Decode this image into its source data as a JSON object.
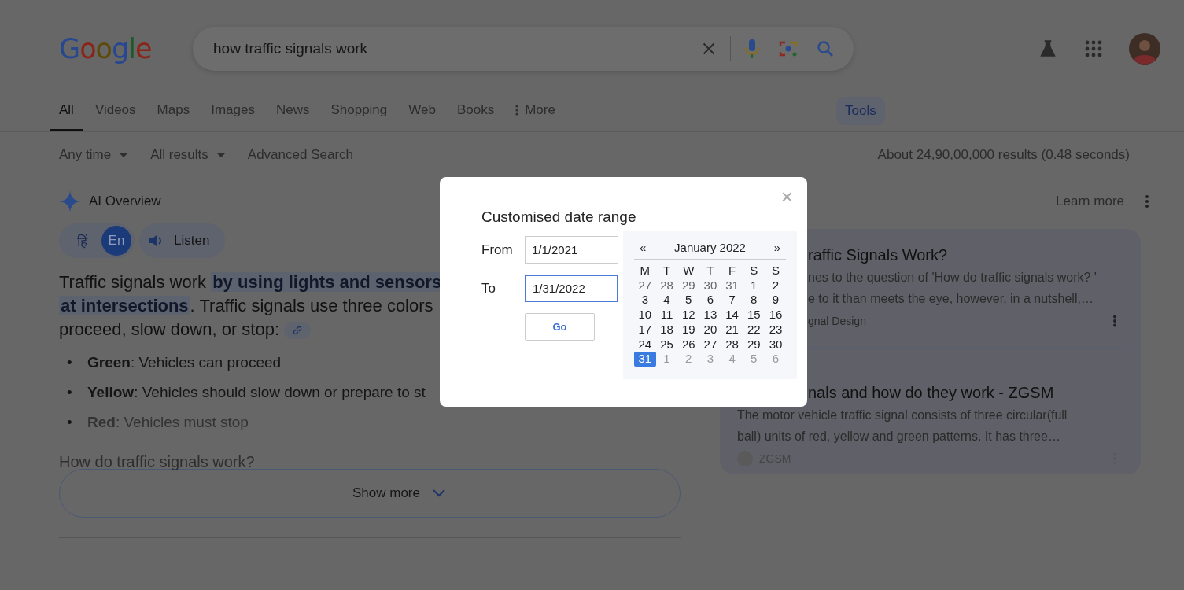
{
  "header": {
    "logo": "Google",
    "query": "how traffic signals work"
  },
  "tabs": [
    {
      "label": "All",
      "selected": true
    },
    {
      "label": "Videos",
      "selected": false
    },
    {
      "label": "Maps",
      "selected": false
    },
    {
      "label": "Images",
      "selected": false
    },
    {
      "label": "News",
      "selected": false
    },
    {
      "label": "Shopping",
      "selected": false
    },
    {
      "label": "Web",
      "selected": false
    },
    {
      "label": "Books",
      "selected": false
    },
    {
      "label": "More",
      "selected": false,
      "kind": "more"
    }
  ],
  "tools": "Tools",
  "filters": [
    {
      "label": "Any time",
      "kind": "dropdown"
    },
    {
      "label": "All results",
      "kind": "dropdown"
    },
    {
      "label": "Advanced Search",
      "kind": "link"
    }
  ],
  "result_stats": "About 24,90,00,000 results (0.48 seconds)",
  "ai_overview": {
    "title": "AI Overview",
    "learn_more": "Learn more",
    "languages": [
      {
        "label": "हिं",
        "selected": false
      },
      {
        "label": "En",
        "selected": true
      }
    ],
    "listen": "Listen",
    "paragraph": [
      "Traffic signals work ",
      "by using lights and sensors",
      "at intersections",
      ". Traffic signals use three colors",
      "proceed, slow down, or stop:"
    ],
    "bullets": [
      {
        "marker": "•",
        "term": "Green",
        "text": ": Vehicles can proceed",
        "faded": false
      },
      {
        "marker": "•",
        "term": "Yellow",
        "text": ": Vehicles should slow down or prepare to st",
        "faded": false
      },
      {
        "marker": "•",
        "term": "Red",
        "text": ": Vehicles must stop",
        "faded": true
      }
    ],
    "faded_heading": "How do traffic signals work?",
    "show_more": "Show more"
  },
  "sources": [
    {
      "title": "raffic Signals Work?",
      "snippet": [
        "nes to the question of 'How do traffic signals work? '",
        "e to it than meets the eye, however, in a nutshell,…"
      ],
      "site": "gnal Design",
      "covered": true
    },
    {
      "title": "nals and how do they work - ZGSM",
      "snippet": [
        "The motor vehicle traffic signal consists of three circular(full",
        "ball) units of red, yellow and green patterns. It has three…"
      ],
      "site": "ZGSM",
      "covered": false
    }
  ],
  "dialog": {
    "title": "Customised date range",
    "close": "×",
    "fields": [
      {
        "label": "From",
        "value": "1/1/2021",
        "focused": false
      },
      {
        "label": "To",
        "value": "1/31/2022",
        "focused": true
      }
    ],
    "go": "Go",
    "calendar": {
      "prev": "«",
      "month": "January 2022",
      "next": "»",
      "weekdays": [
        "M",
        "T",
        "W",
        "T",
        "F",
        "S",
        "S"
      ],
      "days": [
        {
          "d": "27",
          "muted": true,
          "selected": false
        },
        {
          "d": "28",
          "muted": true,
          "selected": false
        },
        {
          "d": "29",
          "muted": true,
          "selected": false
        },
        {
          "d": "30",
          "muted": true,
          "selected": false
        },
        {
          "d": "31",
          "muted": true,
          "selected": false
        },
        {
          "d": "1",
          "muted": false,
          "selected": false
        },
        {
          "d": "2",
          "muted": false,
          "selected": false
        },
        {
          "d": "3",
          "muted": false,
          "selected": false
        },
        {
          "d": "4",
          "muted": false,
          "selected": false
        },
        {
          "d": "5",
          "muted": false,
          "selected": false
        },
        {
          "d": "6",
          "muted": false,
          "selected": false
        },
        {
          "d": "7",
          "muted": false,
          "selected": false
        },
        {
          "d": "8",
          "muted": false,
          "selected": false
        },
        {
          "d": "9",
          "muted": false,
          "selected": false
        },
        {
          "d": "10",
          "muted": false,
          "selected": false
        },
        {
          "d": "11",
          "muted": false,
          "selected": false
        },
        {
          "d": "12",
          "muted": false,
          "selected": false
        },
        {
          "d": "13",
          "muted": false,
          "selected": false
        },
        {
          "d": "14",
          "muted": false,
          "selected": false
        },
        {
          "d": "15",
          "muted": false,
          "selected": false
        },
        {
          "d": "16",
          "muted": false,
          "selected": false
        },
        {
          "d": "17",
          "muted": false,
          "selected": false
        },
        {
          "d": "18",
          "muted": false,
          "selected": false
        },
        {
          "d": "19",
          "muted": false,
          "selected": false
        },
        {
          "d": "20",
          "muted": false,
          "selected": false
        },
        {
          "d": "21",
          "muted": false,
          "selected": false
        },
        {
          "d": "22",
          "muted": false,
          "selected": false
        },
        {
          "d": "23",
          "muted": false,
          "selected": false
        },
        {
          "d": "24",
          "muted": false,
          "selected": false
        },
        {
          "d": "25",
          "muted": false,
          "selected": false
        },
        {
          "d": "26",
          "muted": false,
          "selected": false
        },
        {
          "d": "27",
          "muted": false,
          "selected": false
        },
        {
          "d": "28",
          "muted": false,
          "selected": false
        },
        {
          "d": "29",
          "muted": false,
          "selected": false
        },
        {
          "d": "30",
          "muted": false,
          "selected": false
        },
        {
          "d": "31",
          "muted": false,
          "selected": true
        },
        {
          "d": "1",
          "muted": true,
          "selected": false
        },
        {
          "d": "2",
          "muted": true,
          "selected": false
        },
        {
          "d": "3",
          "muted": true,
          "selected": false
        },
        {
          "d": "4",
          "muted": true,
          "selected": false
        },
        {
          "d": "5",
          "muted": true,
          "selected": false
        },
        {
          "d": "6",
          "muted": true,
          "selected": false
        }
      ]
    }
  }
}
